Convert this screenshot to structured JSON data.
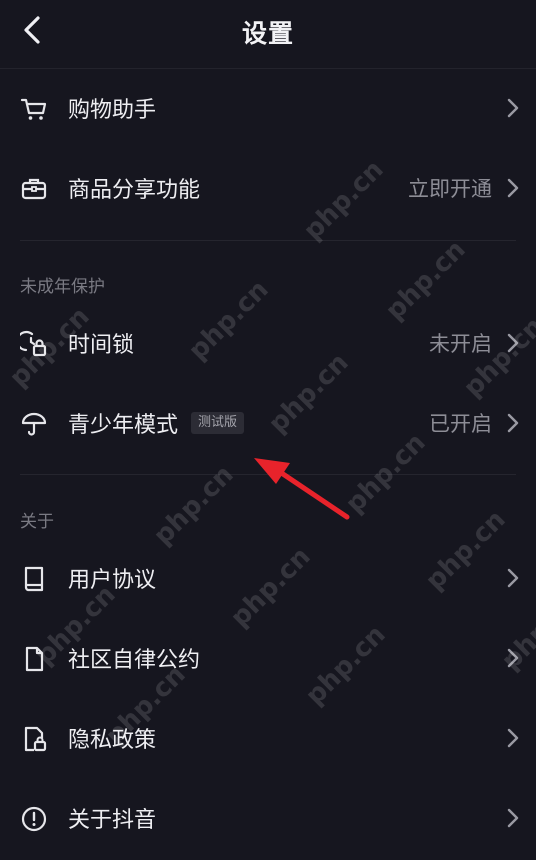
{
  "header": {
    "title": "设置",
    "back_icon": "chevron-left-icon"
  },
  "shopping": {
    "items": [
      {
        "label": "购物助手",
        "value": "",
        "icon": "cart-icon"
      },
      {
        "label": "商品分享功能",
        "value": "立即开通",
        "icon": "briefcase-icon"
      }
    ]
  },
  "minor_protection": {
    "section_title": "未成年保护",
    "items": [
      {
        "label": "时间锁",
        "value": "未开启",
        "icon": "time-lock-icon"
      },
      {
        "label": "青少年模式",
        "badge": "测试版",
        "value": "已开启",
        "icon": "umbrella-icon"
      }
    ]
  },
  "about": {
    "section_title": "关于",
    "items": [
      {
        "label": "用户协议",
        "value": "",
        "icon": "book-icon"
      },
      {
        "label": "社区自律公约",
        "value": "",
        "icon": "document-icon"
      },
      {
        "label": "隐私政策",
        "value": "",
        "icon": "privacy-lock-icon"
      },
      {
        "label": "关于抖音",
        "value": "",
        "icon": "info-icon"
      }
    ]
  },
  "watermark": {
    "text": "php.cn"
  },
  "colors": {
    "background": "#16161f",
    "text": "#eeeef2",
    "secondary_text": "#8d8d96",
    "arrow": "#e8232b"
  }
}
